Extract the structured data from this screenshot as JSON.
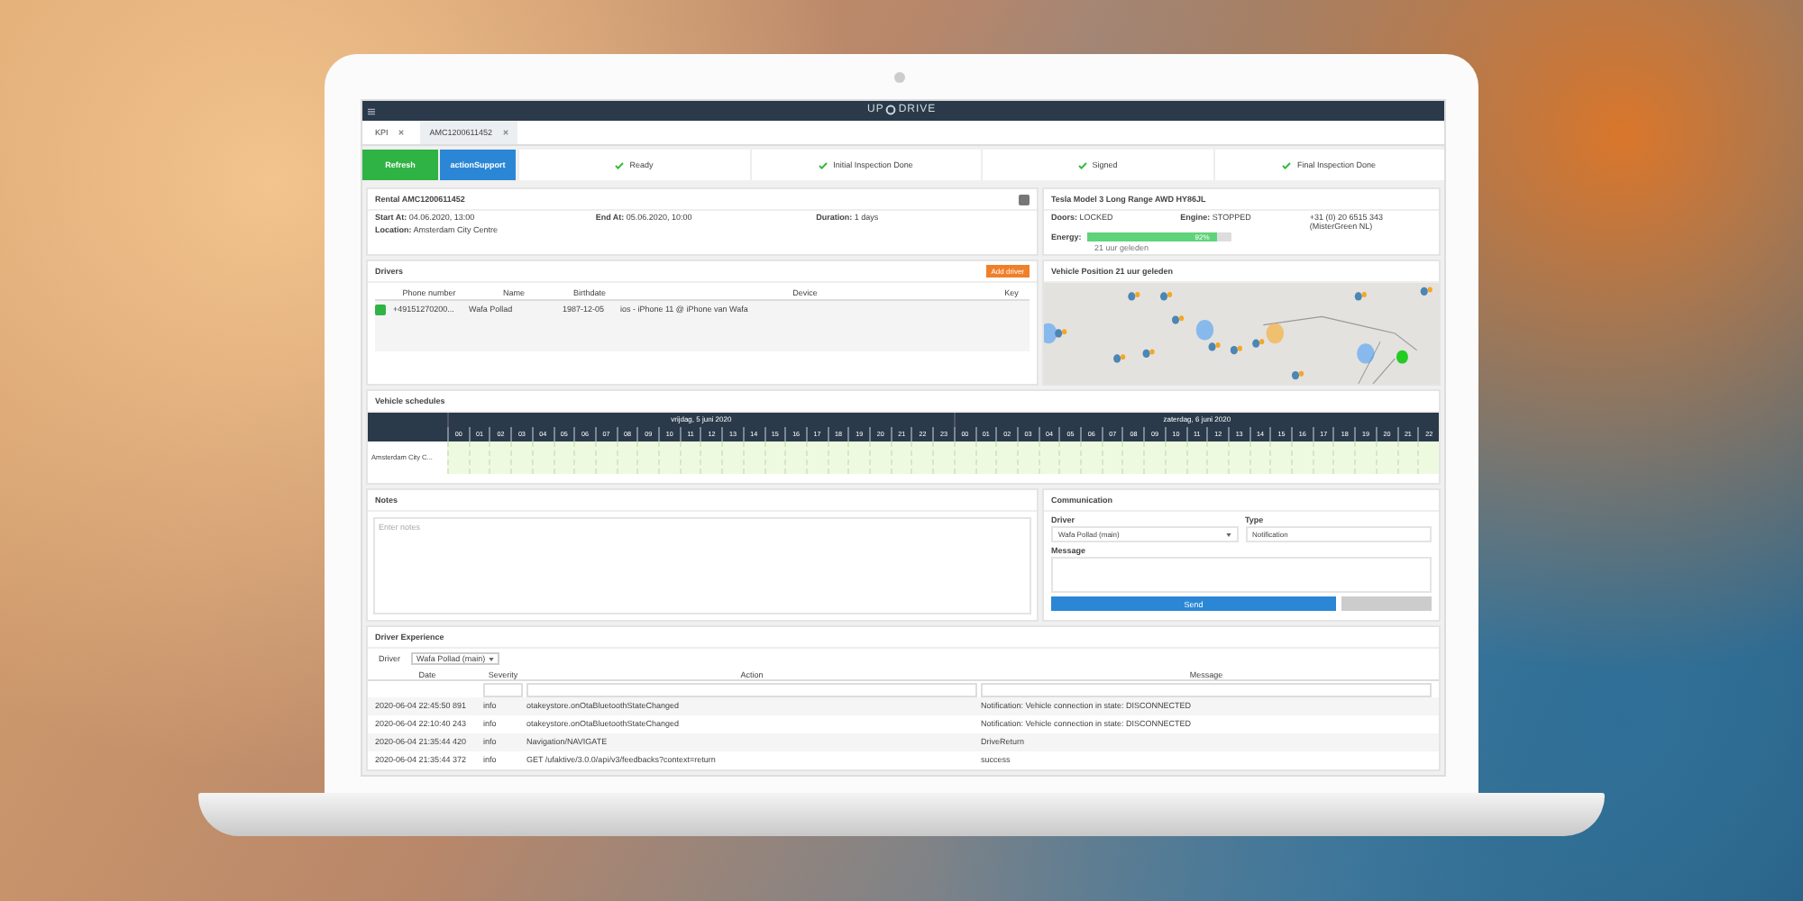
{
  "brand": {
    "left": "UP",
    "right": "DRIVE"
  },
  "tabs": [
    {
      "label": "KPI",
      "selected": false
    },
    {
      "label": "AMC1200611452",
      "selected": true
    }
  ],
  "toolbar": [
    {
      "label": "Refresh",
      "kind": "success"
    },
    {
      "label": "actionSupport",
      "kind": "primary"
    }
  ],
  "steps": [
    {
      "label": "Ready",
      "done": true
    },
    {
      "label": "Initial Inspection Done",
      "done": true
    },
    {
      "label": "Signed",
      "done": true
    },
    {
      "label": "Final Inspection Done",
      "done": true
    }
  ],
  "rental": {
    "title": "Rental AMC1200611452",
    "start_label": "Start At:",
    "start": "04.06.2020, 13:00",
    "end_label": "End At:",
    "end": "05.06.2020, 10:00",
    "duration_label": "Duration:",
    "duration": "1 days",
    "location_label": "Location:",
    "location": "Amsterdam City Centre"
  },
  "vehicle": {
    "title": "Tesla Model 3 Long Range AWD HY86JL",
    "doors_label": "Doors:",
    "doors": "LOCKED",
    "engine_label": "Engine:",
    "engine": "STOPPED",
    "phone": "+31 (0) 20 6515 343 (MisterGreen NL)",
    "energy_label": "Energy:",
    "level": 0.9,
    "energy": "92%",
    "energy_time": "21 uur geleden"
  },
  "drivers": {
    "title": "Drivers",
    "add_button": "Add driver",
    "columns": [
      "Phone number",
      "Name",
      "Birthdate",
      "Device",
      "Key"
    ],
    "rows": [
      {
        "phone": "+49151270200...",
        "name": "Wafa Pollad",
        "birthdate": "1987-12-05",
        "device": "ios - iPhone 11 @ iPhone van Wafa",
        "key": ""
      }
    ]
  },
  "position": {
    "title": "Vehicle Position",
    "time": "21 uur geleden"
  },
  "schedules": {
    "title": "Vehicle schedules",
    "days": [
      {
        "label": "vrijdag, 5 juni 2020",
        "hours": [
          "00",
          "01",
          "02",
          "03",
          "04",
          "05",
          "06",
          "07",
          "08",
          "09",
          "10",
          "11",
          "12",
          "13",
          "14",
          "15",
          "16",
          "17",
          "18",
          "19",
          "20",
          "21",
          "22",
          "23"
        ]
      },
      {
        "label": "zaterdag, 6 juni 2020",
        "hours": [
          "00",
          "01",
          "02",
          "03",
          "04",
          "05",
          "06",
          "07",
          "08",
          "09",
          "10",
          "11",
          "12",
          "13",
          "14",
          "15",
          "16",
          "17",
          "18",
          "19",
          "20",
          "21",
          "22"
        ]
      }
    ],
    "rows": [
      {
        "label": "Amsterdam City C..."
      }
    ]
  },
  "notes": {
    "title": "Notes",
    "placeholder": "Enter notes"
  },
  "communication": {
    "title": "Communication",
    "driver_label": "Driver",
    "driver_value": "Wafa Pollad (main)",
    "type_label": "Type",
    "type_value": "Notification",
    "message_label": "Message",
    "send": "Send"
  },
  "experience": {
    "title": "Driver Experience",
    "driver_label": "Driver",
    "driver_value": "Wafa Pollad (main)",
    "columns": [
      "Date",
      "Severity",
      "Action",
      "Message"
    ],
    "rows": [
      {
        "date": "2020-06-04 22:45:50 891",
        "severity": "info",
        "action": "otakeystore.onOtaBluetoothStateChanged",
        "message": "Notification: Vehicle connection in state: DISCONNECTED"
      },
      {
        "date": "2020-06-04 22:10:40 243",
        "severity": "info",
        "action": "otakeystore.onOtaBluetoothStateChanged",
        "message": "Notification: Vehicle connection in state: DISCONNECTED"
      },
      {
        "date": "2020-06-04 21:35:44 420",
        "severity": "info",
        "action": "Navigation/NAVIGATE",
        "message": "DriveReturn"
      },
      {
        "date": "2020-06-04 21:35:44 372",
        "severity": "info",
        "action": "GET /ufaktive/3.0.0/api/v3/feedbacks?context=return",
        "message": "success"
      }
    ]
  }
}
